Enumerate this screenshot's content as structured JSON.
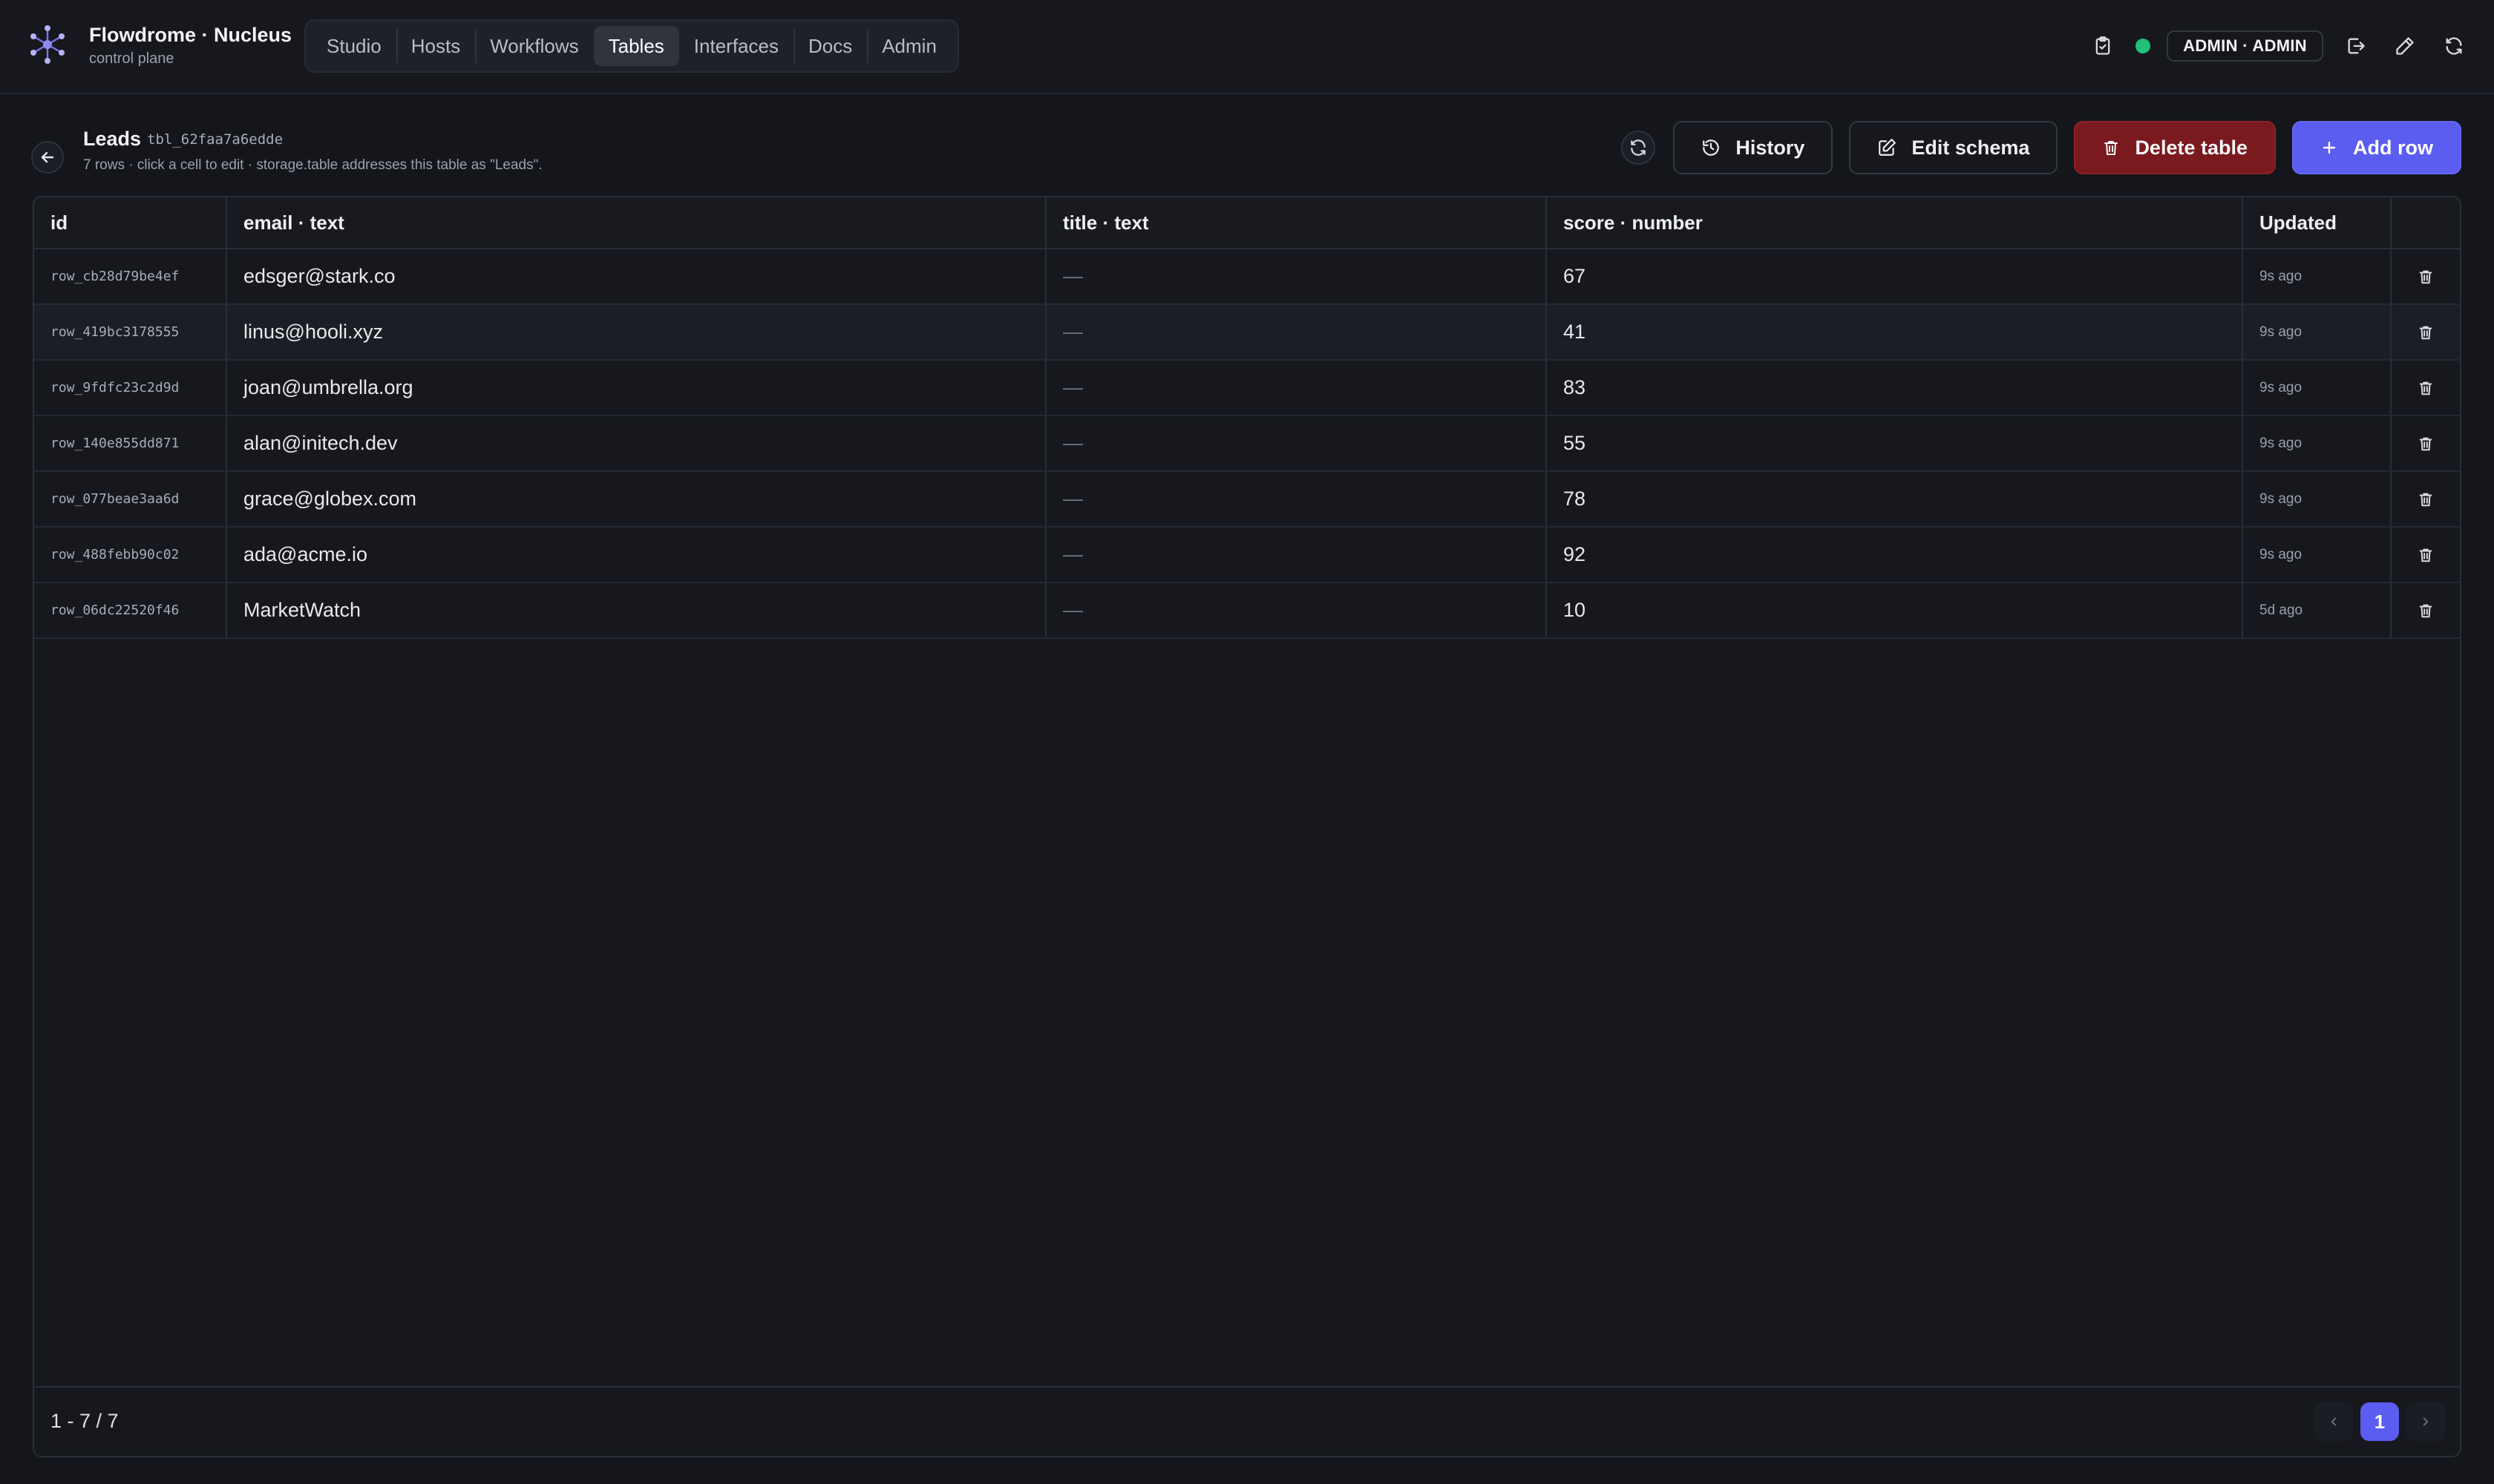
{
  "app": {
    "title": "Flowdrome · Nucleus",
    "subtitle": "control plane"
  },
  "nav": {
    "items": [
      {
        "label": "Studio",
        "active": false
      },
      {
        "label": "Hosts",
        "active": false
      },
      {
        "label": "Workflows",
        "active": false
      },
      {
        "label": "Tables",
        "active": true
      },
      {
        "label": "Interfaces",
        "active": false
      },
      {
        "label": "Docs",
        "active": false
      },
      {
        "label": "Admin",
        "active": false
      }
    ]
  },
  "topbar": {
    "user_label": "ADMIN · ADMIN",
    "status_color": "#22c07a",
    "icons": [
      "clipboard-icon",
      "status-dot",
      "logout-icon",
      "edit-icon",
      "refresh-icon"
    ]
  },
  "page": {
    "table_name": "Leads",
    "table_id": "tbl_62faa7a6edde",
    "subtitle": "7 rows · click a cell to edit · storage.table addresses this table as \"Leads\".",
    "buttons": {
      "history": "History",
      "edit_schema": "Edit schema",
      "delete_table": "Delete table",
      "add_row": "Add row"
    }
  },
  "table": {
    "columns": [
      "id",
      "email · text",
      "title · text",
      "score · number",
      "Updated"
    ],
    "rows": [
      {
        "id": "row_cb28d79be4ef",
        "email": "edsger@stark.co",
        "title": "—",
        "score": "67",
        "updated": "9s ago"
      },
      {
        "id": "row_419bc3178555",
        "email": "linus@hooli.xyz",
        "title": "—",
        "score": "41",
        "updated": "9s ago"
      },
      {
        "id": "row_9fdfc23c2d9d",
        "email": "joan@umbrella.org",
        "title": "—",
        "score": "83",
        "updated": "9s ago"
      },
      {
        "id": "row_140e855dd871",
        "email": "alan@initech.dev",
        "title": "—",
        "score": "55",
        "updated": "9s ago"
      },
      {
        "id": "row_077beae3aa6d",
        "email": "grace@globex.com",
        "title": "—",
        "score": "78",
        "updated": "9s ago"
      },
      {
        "id": "row_488febb90c02",
        "email": "ada@acme.io",
        "title": "—",
        "score": "92",
        "updated": "9s ago"
      },
      {
        "id": "row_06dc22520f46",
        "email": "MarketWatch",
        "title": "—",
        "score": "10",
        "updated": "5d ago"
      }
    ]
  },
  "footer": {
    "range": "1 - 7 / 7",
    "current_page": "1"
  },
  "colors": {
    "accent": "#5b5cf0",
    "danger": "#7a1a1f",
    "status_online": "#22c07a"
  }
}
